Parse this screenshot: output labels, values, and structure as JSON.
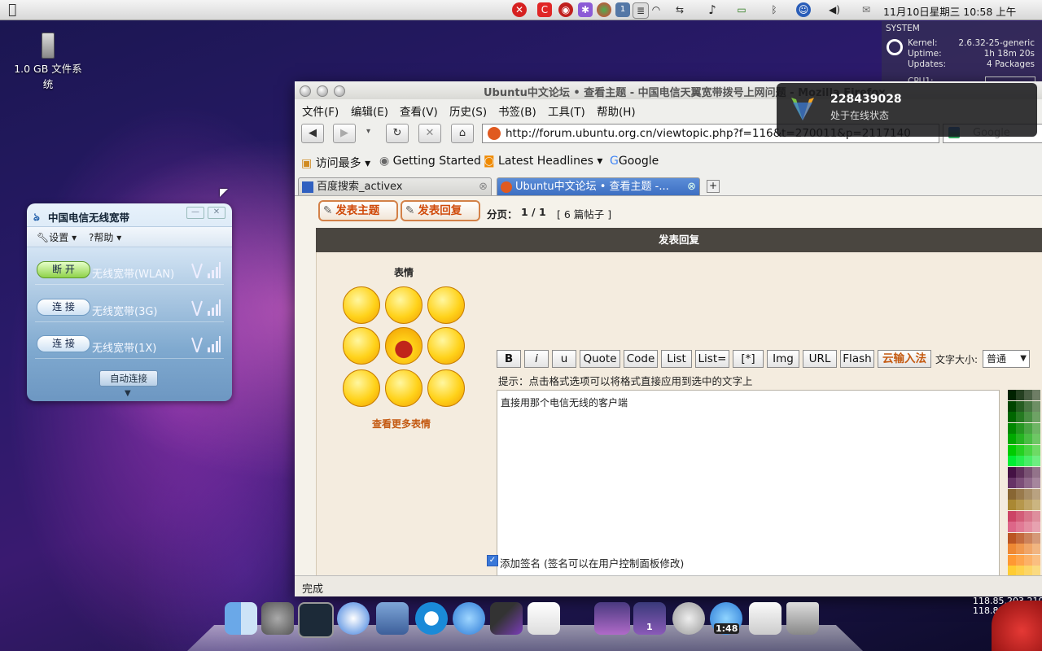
{
  "menubar": {
    "clock": "11月10日星期三 10:58 上午",
    "tray_icons": [
      "close-icon",
      "c-app-icon",
      "weibo-icon",
      "settings-star-icon",
      "chrome-like-icon",
      "notes-icon",
      "document-icon",
      "wifi-icon",
      "network-icon",
      "music-note-icon",
      "battery-icon",
      "bluetooth-icon",
      "accessibility-icon",
      "volume-icon",
      "mail-icon"
    ],
    "tray_badge": "1"
  },
  "desktop": {
    "drive_label": "1.0 GB 文件系统"
  },
  "sysmon": {
    "header": "SYSTEM",
    "kernel_label": "Kernel:",
    "kernel_value": "2.6.32-25-generic",
    "uptime_label": "Uptime:",
    "uptime_value": "1h 18m 20s",
    "updates_label": "Updates:",
    "updates_value": "4 Packages",
    "cpu_label": "CPU1:"
  },
  "telecom": {
    "title": "中国电信无线宽带",
    "menu": {
      "settings": "设置",
      "help": "帮助"
    },
    "rows": [
      {
        "button": "断 开",
        "label": "无线宽带(WLAN)",
        "connected": true
      },
      {
        "button": "连 接",
        "label": "无线宽带(3G)",
        "connected": false
      },
      {
        "button": "连 接",
        "label": "无线宽带(1X)",
        "connected": false
      }
    ],
    "auto_connect": "自动连接"
  },
  "firefox": {
    "title": "Ubuntu中文论坛 • 查看主题 - 中国电信天翼宽带拨号上网问题 - Mozilla Firefox",
    "menus": [
      "文件(F)",
      "编辑(E)",
      "查看(V)",
      "历史(S)",
      "书签(B)",
      "工具(T)",
      "帮助(H)"
    ],
    "url": "http://forum.ubuntu.org.cn/viewtopic.php?f=116&t=270011&p=2117140",
    "search_placeholder": "Google",
    "bookmarks": [
      "访问最多",
      "Getting Started",
      "Latest Headlines",
      "Google"
    ],
    "tabs": [
      {
        "label": "百度搜索_activex",
        "active": false
      },
      {
        "label": "Ubuntu中文论坛 • 查看主题 -...",
        "active": true
      }
    ],
    "new_tab": "+",
    "status": "完成"
  },
  "forum": {
    "new_topic": "发表主题",
    "post_reply": "发表回复",
    "pagination_label": "分页：",
    "pagination_value": "1 / 1",
    "post_count": "[ 6 篇帖子 ]",
    "reply_header": "发表回复",
    "smilies_title": "表情",
    "more_smilies": "查看更多表情",
    "format_buttons": [
      "B",
      "i",
      "u",
      "Quote",
      "Code",
      "List",
      "List=",
      "[*]",
      "Img",
      "URL",
      "Flash",
      "云输入法"
    ],
    "font_size_label": "文字大小:",
    "font_size_value": "普通",
    "hint": "提示：点击格式选项可以将格式直接应用到选中的文字上",
    "message": "直接用那个电信无线的客户端",
    "attach_signature": "添加签名 (签名可以在用户控制面板修改)"
  },
  "notification": {
    "number": "228439028",
    "status": "处于在线状态"
  },
  "dock": {
    "clock_label": "1:48",
    "badge": "1"
  },
  "ip": {
    "line1": "118.85.203.210",
    "line2": "118.85"
  },
  "colors": {
    "accent_blue": "#3d6fc2",
    "forum_orange": "#d04a0a",
    "reply_header": "#4a4640"
  }
}
